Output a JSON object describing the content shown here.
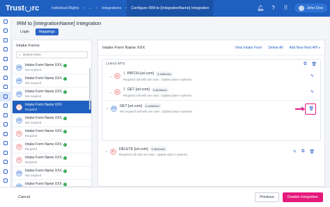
{
  "app": {
    "logo_text": "TrustArc"
  },
  "breadcrumbs": [
    "Individual Rights",
    "...",
    "Integrations",
    "Configure IRM to [IntegrationName] Integration"
  ],
  "top_icons": [
    "bell-icon",
    "help-icon",
    "grid-icon"
  ],
  "user": {
    "name": "John Doe"
  },
  "rail_icons": [
    "home-icon",
    "data-icon",
    "shield-icon",
    "chart-icon",
    "file-icon",
    "network-icon",
    "dashboard-icon",
    "people-icon",
    "grid-icon",
    "nodes-icon",
    "gear-icon",
    "lock-icon",
    "doc-icon",
    "stack-icon",
    "book-icon",
    "tag-icon",
    "puzzle-icon",
    "settings-icon"
  ],
  "page": {
    "title": "IRM to [IntegrationName] Integration",
    "tabs": [
      {
        "label": "Login"
      },
      {
        "label": "Mappings"
      }
    ],
    "active_tab": "Mappings"
  },
  "intake": {
    "heading": "Intake Forms",
    "search_placeholder": "Search here",
    "forms": [
      {
        "initials": "NR",
        "name": "Intake Form Name XXX",
        "sub": "Not required",
        "type": "nr",
        "check": true
      },
      {
        "initials": "NR",
        "name": "Intake Form Name XXX",
        "sub": "Not required",
        "type": "nr",
        "check": true
      },
      {
        "initials": "NR",
        "name": "Intake Form Name XXX",
        "sub": "Not required",
        "type": "nr",
        "check": true
      },
      {
        "initials": "R",
        "name": "Intake Form Name XXX",
        "sub": "Required",
        "type": "r",
        "check": false,
        "selected": true
      },
      {
        "initials": "NR",
        "name": "Intake Form Name XXX",
        "sub": "Not required",
        "type": "nr",
        "check": true
      },
      {
        "initials": "R",
        "name": "Intake Form Name XXX",
        "sub": "Required",
        "type": "r",
        "check": true
      },
      {
        "initials": "R",
        "name": "Intake Form Name XXX",
        "sub": "Required",
        "type": "r",
        "check": true
      },
      {
        "initials": "R",
        "name": "Intake Form Name XXX",
        "sub": "Required",
        "type": "r",
        "check": true
      },
      {
        "initials": "NR",
        "name": "Intake Form Name XXX",
        "sub": "Not required",
        "type": "nr",
        "check": true
      },
      {
        "initials": "NR",
        "name": "Intake Form Name XXX",
        "sub": "Not required",
        "type": "nr",
        "check": true
      }
    ]
  },
  "detail": {
    "title": "Intake Form Name XXX",
    "view_btn": "View Intake Form",
    "delete_all_btn": "Delete All",
    "add_btn": "Add New Rest API",
    "linked_heading": "Linked APIs",
    "linked_apis": [
      {
        "num": "1",
        "badge": "R",
        "badge_type": "r",
        "title": "PATCH [url.com]",
        "attrs": "5 attributes",
        "sub": "Required call with use case : Update data in systems",
        "nested": true,
        "highlight": false
      },
      {
        "num": "2",
        "badge": "R",
        "badge_type": "r",
        "title": "GET [url.com]",
        "attrs": "5 attributes",
        "sub": "Required call with use case : Update data in systems",
        "nested": true,
        "highlight": false
      },
      {
        "num": "",
        "badge": "NR",
        "badge_type": "nr",
        "title": "GET [url.com]",
        "attrs": "5 attributes",
        "sub": "Not required call with use case : Update data in systems",
        "nested": false,
        "highlight": true
      }
    ],
    "standalone": {
      "badge": "R",
      "badge_type": "r",
      "title": "DELETE [url.com]",
      "attrs": "5 attributes",
      "sub": "Required call with use case : Update data in systems"
    }
  },
  "footer": {
    "cancel": "Cancel",
    "previous": "Previous",
    "disable": "Disable Integration"
  },
  "colors": {
    "brand": "#1f5fbf",
    "accent": "#e5197b"
  }
}
